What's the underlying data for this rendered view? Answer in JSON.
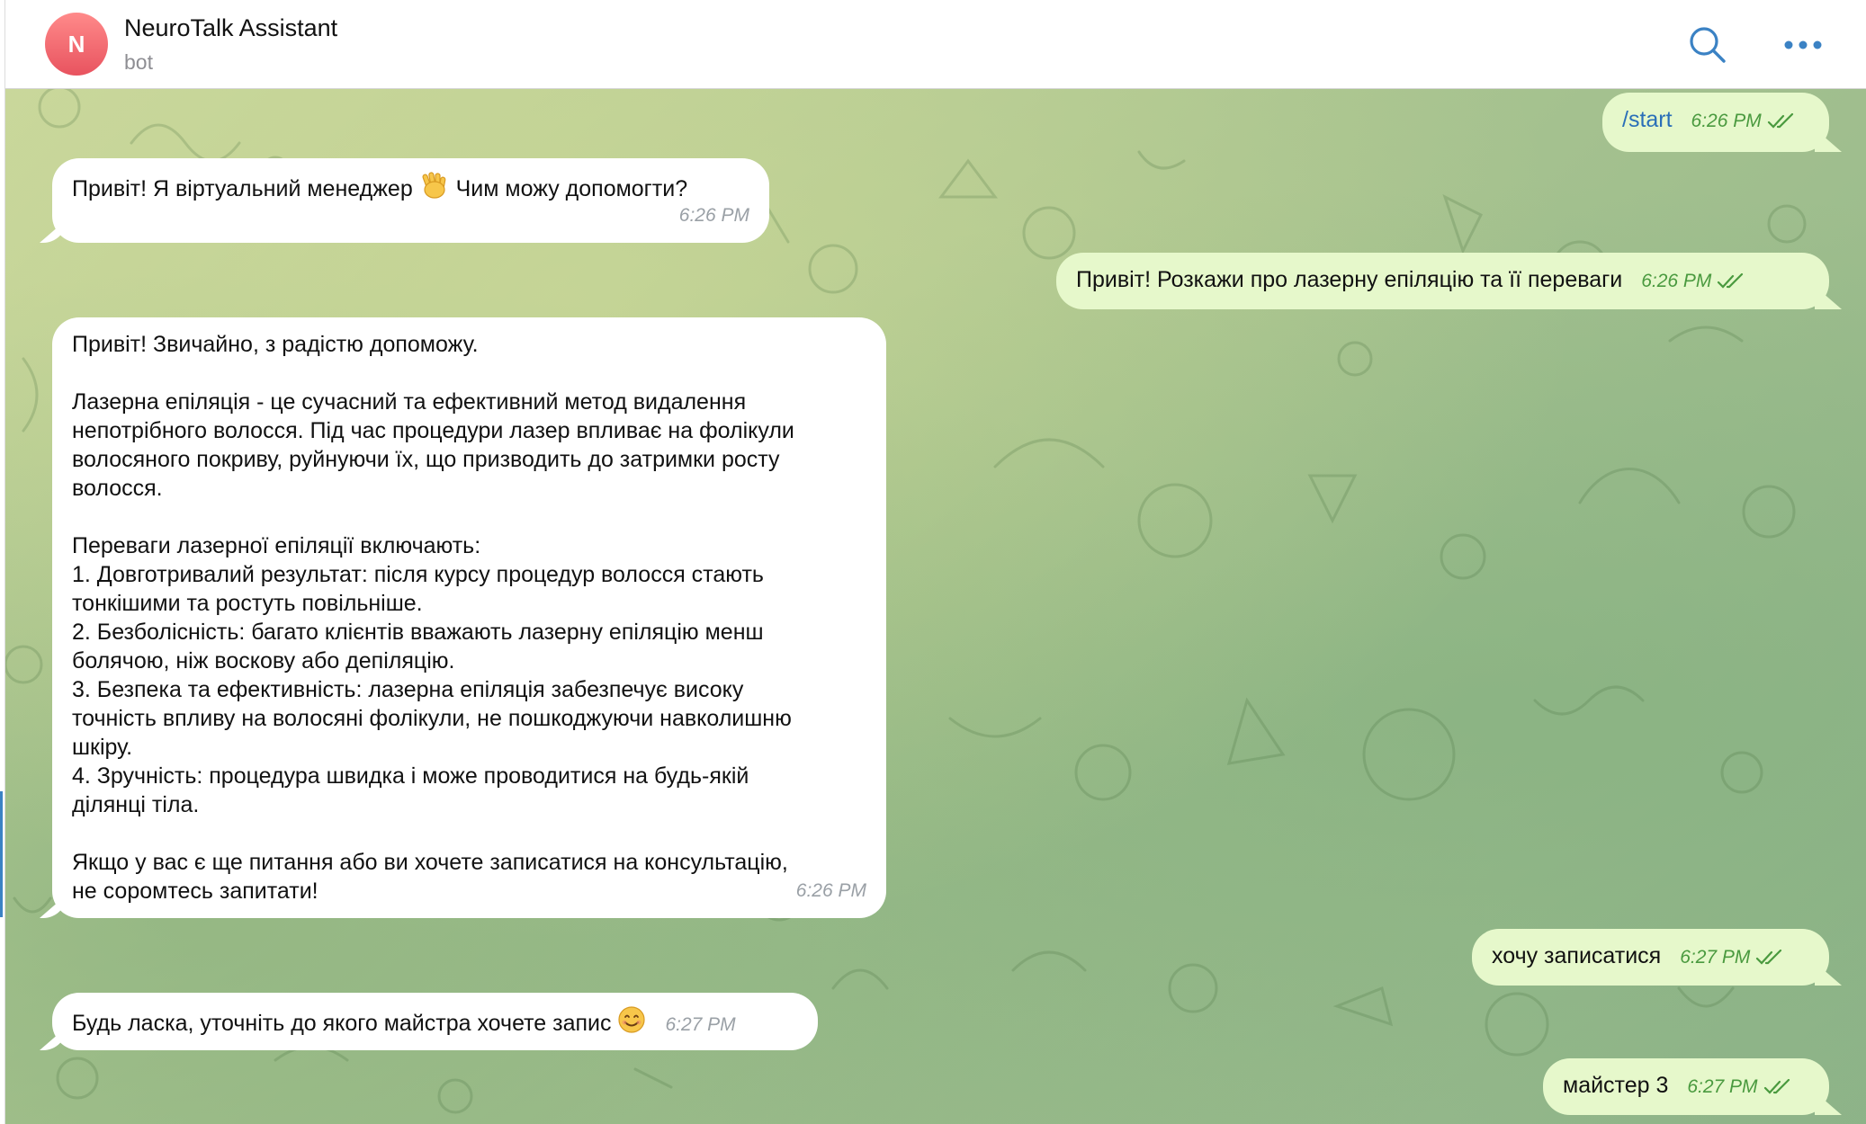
{
  "header": {
    "avatar_letter": "N",
    "title": "NeuroTalk Assistant",
    "subtitle": "bot"
  },
  "messages": [
    {
      "direction": "out",
      "text": "/start",
      "time": "6:26 PM",
      "status": "read"
    },
    {
      "direction": "in",
      "text": "Привіт! Я віртуальний менеджер",
      "text_after": "Чим можу допомогти?",
      "emoji": "waving-hand",
      "time": "6:26 PM"
    },
    {
      "direction": "out",
      "text": "Привіт! Розкажи про лазерну епіляцію та її переваги",
      "time": "6:26 PM",
      "status": "read"
    },
    {
      "direction": "in",
      "text": "Привіт! Звичайно, з радістю допоможу.\n\nЛазерна епіляція - це сучасний та ефективний метод видалення\nнепотрібного волосся. Під час процедури лазер впливає на фолікули\nволосяного покриву, руйнуючи їх, що призводить до затримки росту\nволосся.\n\nПереваги лазерної епіляції включають:\n1. Довготривалий результат: після курсу процедур волосся стають\nтонкішими та ростуть повільніше.\n2. Безболісність: багато клієнтів вважають лазерну епіляцію менш\nболячою, ніж воскову або депіляцію.\n3. Безпека та ефективність: лазерна епіляція забезпечує високу\nточність впливу на волосяні фолікули, не пошкоджуючи навколишню\nшкіру.\n4. Зручність: процедура швидка і може проводитися на будь-якій\nділянці тіла.\n\nЯкщо у вас є ще питання або ви хочете записатися на консультацію,\nне соромтесь запитати!",
      "time": "6:26 PM"
    },
    {
      "direction": "out",
      "text": "хочу записатися",
      "time": "6:27 PM",
      "status": "read"
    },
    {
      "direction": "in",
      "text": "Будь ласка, уточніть до якого майстра хочете запис",
      "emoji": "smiling-face",
      "time": "6:27 PM"
    },
    {
      "direction": "out",
      "text": "майстер 3",
      "time": "6:27 PM",
      "status": "read"
    }
  ]
}
